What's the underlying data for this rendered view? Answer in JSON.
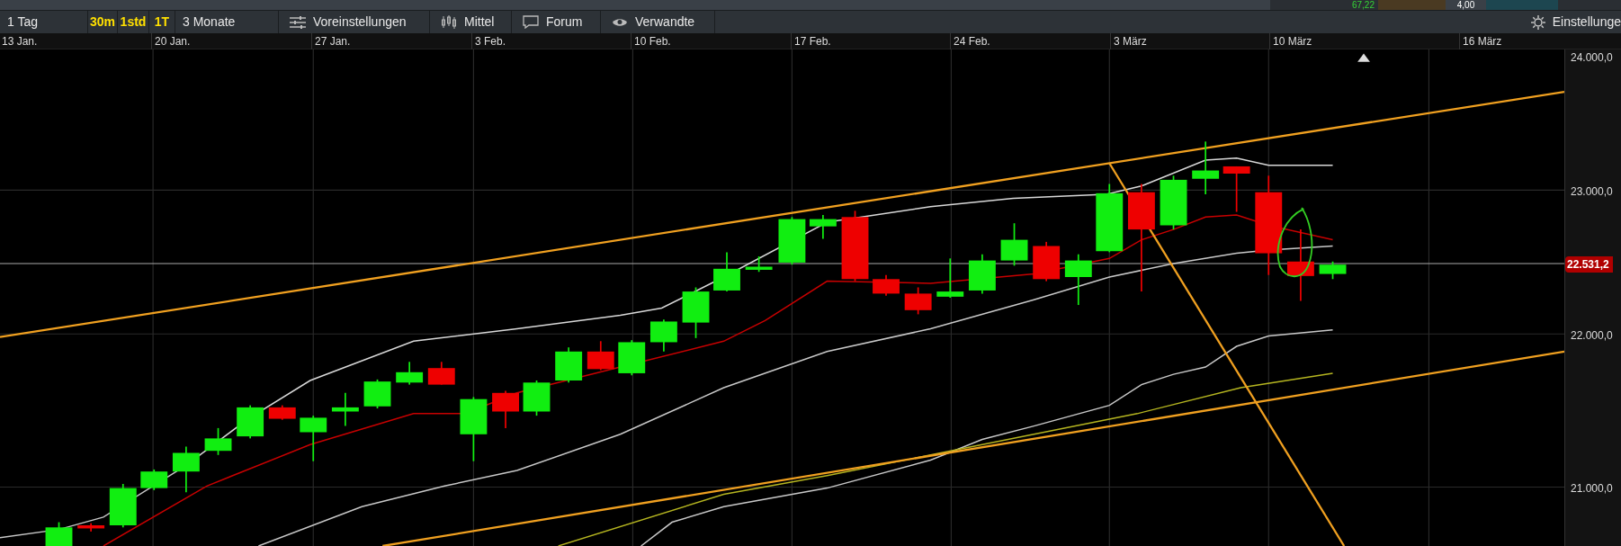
{
  "top_strip": {
    "value_1": "67,22",
    "value_2": "4,00"
  },
  "toolbar": {
    "items": [
      {
        "label": "1 Tag",
        "kind": "range"
      },
      {
        "label": "30m",
        "kind": "interval"
      },
      {
        "label": "1std",
        "kind": "interval"
      },
      {
        "label": "1T",
        "kind": "interval"
      },
      {
        "label": "3 Monate",
        "kind": "range"
      },
      {
        "label": "Voreinstellungen",
        "kind": "tool"
      },
      {
        "label": "Mittel",
        "kind": "tool"
      },
      {
        "label": "Forum",
        "kind": "tool"
      },
      {
        "label": "Verwandte",
        "kind": "tool"
      }
    ],
    "settings": "Einstellunge"
  },
  "x_axis": {
    "labels": [
      "13 Jan.",
      "20 Jan.",
      "27 Jan.",
      "3 Feb.",
      "10 Feb.",
      "17 Feb.",
      "24 Feb.",
      "3 März",
      "10 März",
      "16 März"
    ]
  },
  "y_axis": {
    "labels": [
      "24.000,0",
      "23.000,0",
      "22.000,0",
      "21.000,0"
    ],
    "current_price": "22.531,2"
  }
}
